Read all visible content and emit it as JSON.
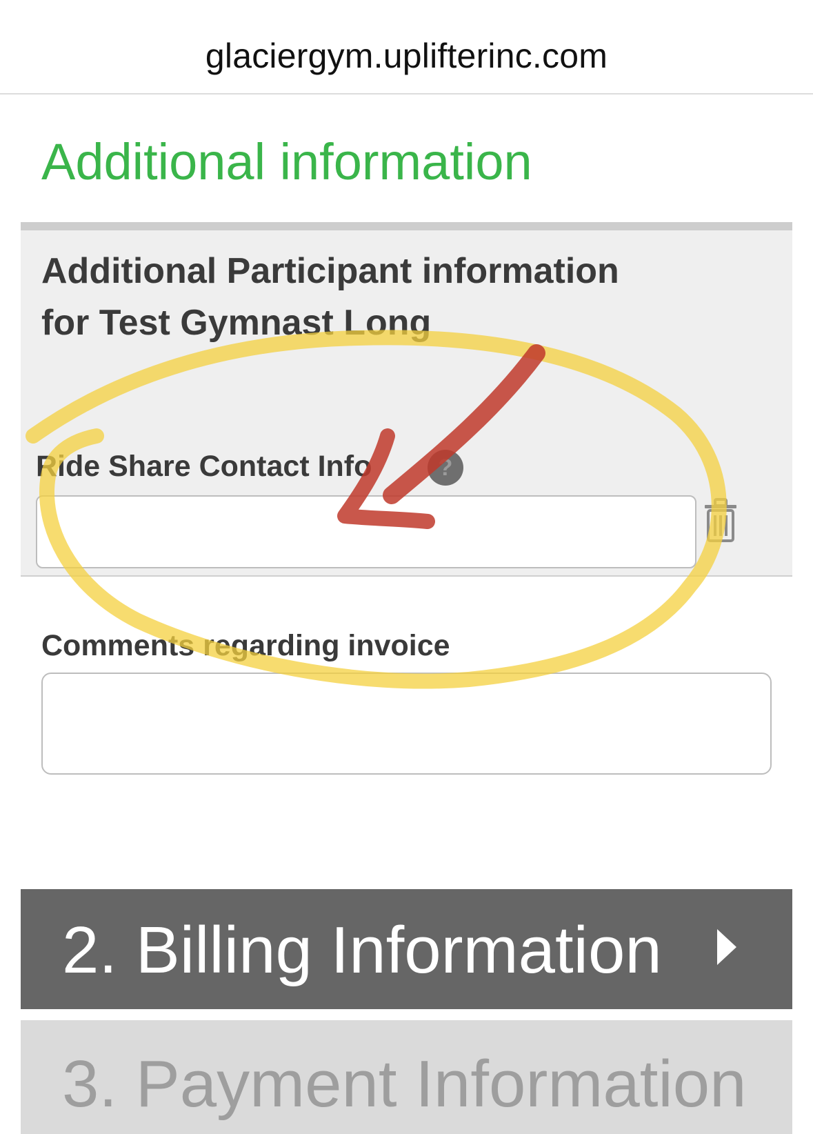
{
  "browser": {
    "url": "glaciergym.uplifterinc.com"
  },
  "main": {
    "section_title": "Additional information",
    "participant": {
      "heading": "Additional Participant information for Test Gymnast Long",
      "field_label": "Ride Share Contact Info",
      "help_icon": "?",
      "field_value": ""
    },
    "comments": {
      "label": "Comments regarding invoice",
      "value": ""
    }
  },
  "steps": [
    {
      "label": "2. Billing Information",
      "state": "active"
    },
    {
      "label": "3. Payment Information",
      "state": "disabled"
    }
  ],
  "colors": {
    "section_title": "#3ab54a",
    "step_active_bg": "#666666",
    "step_disabled_bg": "#dadada",
    "annotation_circle": "#f4d03f",
    "annotation_arrow": "#c0392b"
  },
  "icons": {
    "trash": "trash-icon",
    "help": "help-icon",
    "chevron": "chevron-right-icon"
  }
}
